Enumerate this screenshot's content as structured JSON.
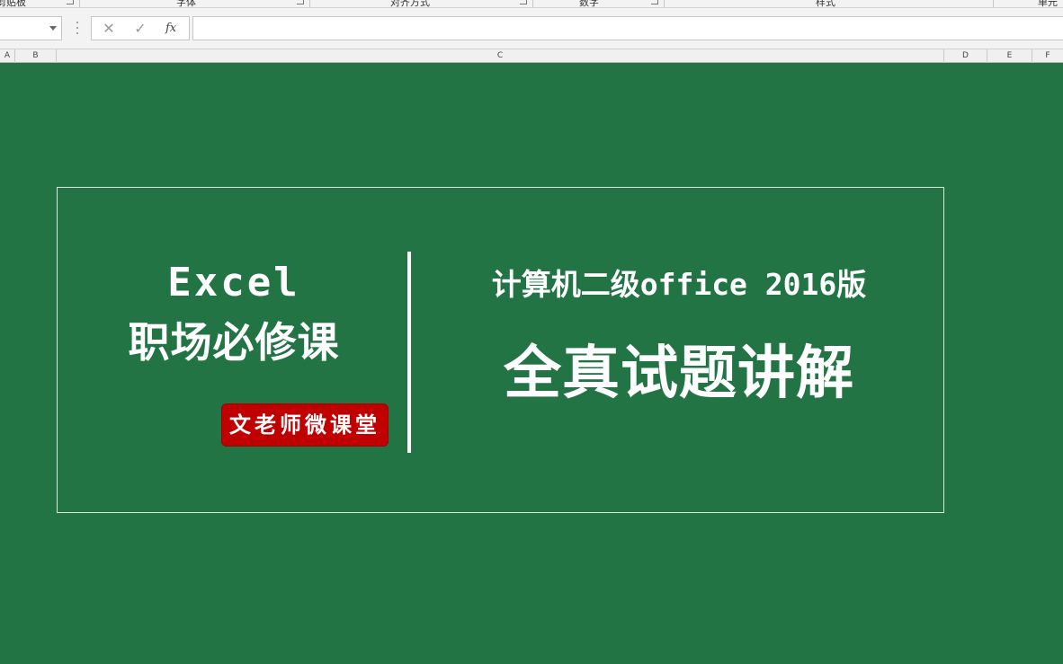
{
  "ribbon": {
    "groups": [
      {
        "label": "剪贴板"
      },
      {
        "label": "字体"
      },
      {
        "label": "对齐方式"
      },
      {
        "label": "数字"
      },
      {
        "label": "样式"
      },
      {
        "label": "单元"
      }
    ]
  },
  "formula_bar": {
    "name_box_value": "",
    "cancel_icon": "✕",
    "enter_icon": "✓",
    "fx_label": "fx",
    "formula_value": ""
  },
  "columns": [
    "A",
    "B",
    "C",
    "D",
    "E",
    "F"
  ],
  "slide": {
    "left_title": "Excel",
    "left_subtitle": "职场必修课",
    "badge": "文老师微课堂",
    "right_top": "计算机二级office 2016版",
    "right_main": "全真试题讲解"
  },
  "colors": {
    "background": "#227445",
    "badge": "#c00000",
    "text": "#ffffff"
  }
}
